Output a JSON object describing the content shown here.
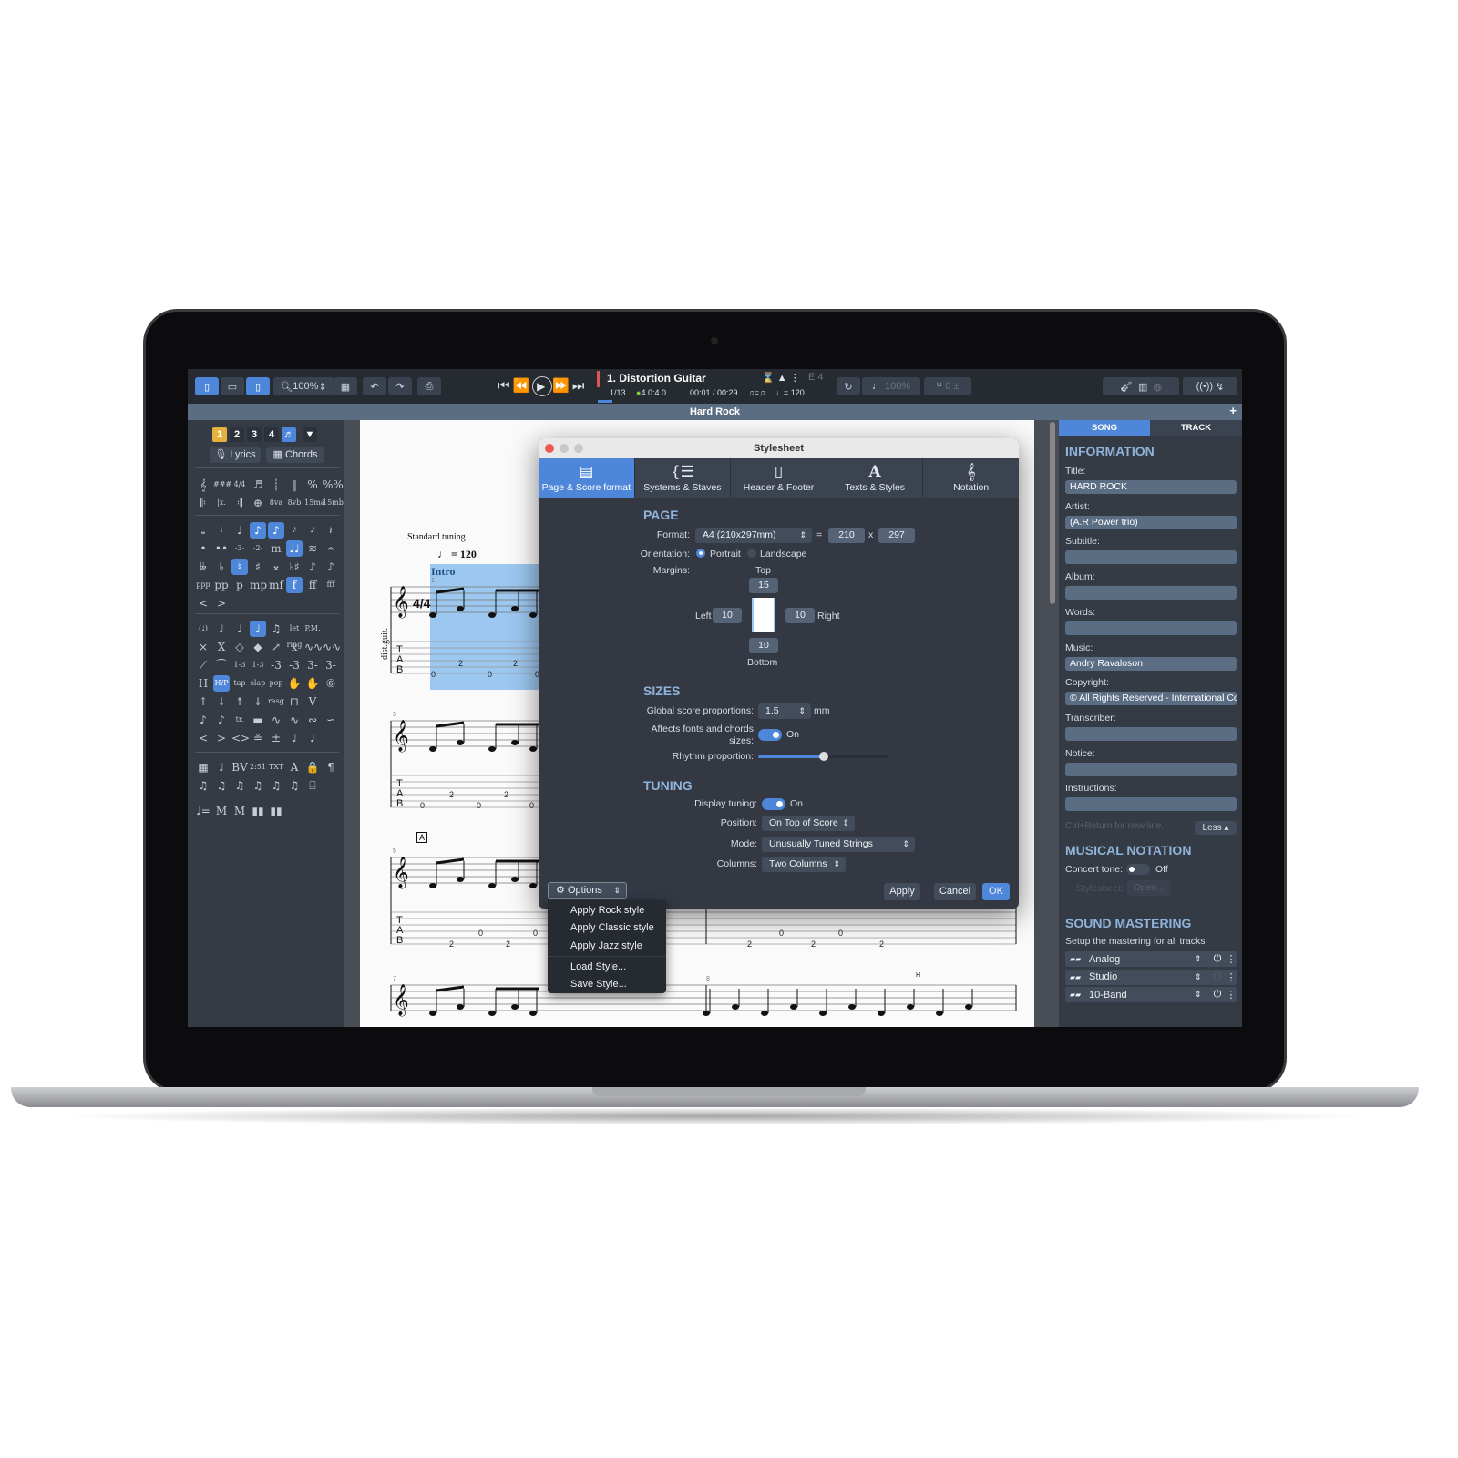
{
  "toolbar": {
    "zoom": "100%",
    "track_name": "1. Distortion Guitar",
    "bar_position": "1/13",
    "time_signature": "4.0:4.0",
    "time": "00:01 / 00:29",
    "tempo_swing": "♫=♫",
    "tempo": "♩= 120",
    "tuning_note": "E 4",
    "speed": "100%",
    "pitch": "0"
  },
  "title_bar": "Hard Rock",
  "left_panel": {
    "voices": [
      "1",
      "2",
      "3",
      "4"
    ],
    "lyrics_label": "Lyrics",
    "chords_label": "Chords",
    "palette_rows": [
      [
        "𝄞",
        "###",
        "4/4",
        "♬",
        "┊",
        "‖",
        "%",
        "%%"
      ],
      [
        "𝄆",
        "|x.",
        "𝄇",
        "⊕",
        "8va",
        "8vb",
        "15ma",
        "15mb"
      ],
      [
        "𝅝",
        "𝅗𝅥",
        "♩",
        "♪",
        "♪",
        "𝅘𝅥𝅯",
        "𝅘𝅥𝅰",
        "𝄽"
      ],
      [
        "•",
        "••",
        "-3-",
        "-2-",
        "m",
        "♩♩",
        "≋",
        "𝄐"
      ],
      [
        "𝄫",
        "♭",
        "♮",
        "♯",
        "𝄪",
        "♭♯",
        "♪",
        "♪"
      ],
      [
        "ppp",
        "pp",
        "p",
        "mp",
        "mf",
        "f",
        "ff",
        "fff"
      ],
      [
        "<",
        ">",
        "",
        "",
        "",
        "",
        "",
        ""
      ],
      [
        "(♩)",
        "♩",
        "♩",
        "♩",
        "♫",
        "let ring",
        "P.M.",
        ""
      ],
      [
        "×",
        "X",
        "◇",
        "◆",
        "↗",
        "x",
        "∿∿",
        "∿∿"
      ],
      [
        "⟋",
        "⁀",
        "1-3",
        "1-3",
        "-3",
        "-3",
        "3-",
        "3-"
      ],
      [
        "H",
        "H/P",
        "tap",
        "slap",
        "pop",
        "✋",
        "✋",
        "⑥"
      ],
      [
        "↑",
        "↓",
        "↟",
        "↡",
        "rasg.",
        "⊓",
        "V",
        ""
      ],
      [
        "♪",
        "♪",
        "tr.",
        "▬",
        "∿",
        "∿",
        "∾",
        "∽"
      ],
      [
        "<",
        ">",
        "<>",
        "≗",
        "±",
        "♩",
        "♩",
        ""
      ],
      [
        "▦",
        "♩",
        "BV",
        "2:51",
        "TXT",
        "A",
        "🔒",
        "¶"
      ],
      [
        "♫",
        "♫",
        "♫",
        "♫",
        "♫",
        "♫",
        "⌸",
        ""
      ],
      [
        "♩=",
        "M",
        "M",
        "▮▮",
        "▮▮",
        "",
        "",
        ""
      ]
    ]
  },
  "score": {
    "tuning_text": "Standard tuning",
    "tempo_text": "♩ = 120",
    "section": "Intro",
    "instrument": "dist.guit.",
    "rehearsal": "A",
    "bar_numbers": [
      "1",
      "3",
      "5",
      "7",
      "8"
    ],
    "tab_letters": [
      "T",
      "A",
      "B"
    ],
    "tab_row1": [
      "0",
      "2",
      "0",
      "2",
      "0"
    ],
    "tab_row2": [
      "0",
      "2",
      "0",
      "2",
      "0"
    ],
    "tab_row3": [
      "2",
      "0",
      "2",
      "0",
      "2",
      "0",
      "2",
      "0",
      "2"
    ],
    "hammer": "H"
  },
  "dialog": {
    "title": "Stylesheet",
    "tabs": [
      {
        "label": "Page & Score format",
        "icon": "page-icon",
        "glyph": "▤"
      },
      {
        "label": "Systems & Staves",
        "icon": "systems-icon",
        "glyph": "{☰"
      },
      {
        "label": "Header & Footer",
        "icon": "header-footer-icon",
        "glyph": "▯"
      },
      {
        "label": "Texts & Styles",
        "icon": "text-icon",
        "glyph": "A"
      },
      {
        "label": "Notation",
        "icon": "treble-clef-icon",
        "glyph": "𝄞"
      }
    ],
    "page": {
      "heading": "PAGE",
      "format_label": "Format:",
      "format_value": "A4 (210x297mm)",
      "equals": "=",
      "width": "210",
      "x": "x",
      "height": "297",
      "orientation_label": "Orientation:",
      "portrait": "Portrait",
      "landscape": "Landscape",
      "margins_label": "Margins:",
      "top_label": "Top",
      "top": "15",
      "left_label": "Left",
      "left": "10",
      "right": "10",
      "right_label": "Right",
      "bottom": "10",
      "bottom_label": "Bottom"
    },
    "sizes": {
      "heading": "SIZES",
      "global_label": "Global score proportions:",
      "global_value": "1.5",
      "unit": "mm",
      "affects_label": "Affects fonts and chords sizes:",
      "affects_state": "On",
      "rhythm_label": "Rhythm proportion:",
      "rhythm_value": 0.5
    },
    "tuning": {
      "heading": "TUNING",
      "display_label": "Display tuning:",
      "display_state": "On",
      "position_label": "Position:",
      "position_value": "On Top of Score",
      "mode_label": "Mode:",
      "mode_value": "Unusually Tuned Strings",
      "columns_label": "Columns:",
      "columns_value": "Two Columns"
    },
    "options_label": "Options",
    "apply": "Apply",
    "cancel": "Cancel",
    "ok": "OK",
    "menu": [
      "Apply Rock style",
      "Apply Classic style",
      "Apply Jazz style",
      "Load Style...",
      "Save Style..."
    ]
  },
  "right_panel": {
    "tabs": [
      "SONG",
      "TRACK"
    ],
    "info_heading": "INFORMATION",
    "fields": [
      {
        "label": "Title:",
        "value": "HARD ROCK"
      },
      {
        "label": "Artist:",
        "value": "(A.R Power trio)"
      },
      {
        "label": "Subtitle:",
        "value": ""
      },
      {
        "label": "Album:",
        "value": ""
      },
      {
        "label": "Words:",
        "value": ""
      },
      {
        "label": "Music:",
        "value": "Andry Ravaloson"
      },
      {
        "label": "Copyright:",
        "value": "© All Rights Reserved - International Copyright"
      },
      {
        "label": "Transcriber:",
        "value": ""
      },
      {
        "label": "Notice:",
        "value": ""
      },
      {
        "label": "Instructions:",
        "value": ""
      }
    ],
    "hint": "Ctrl+Return for new line.",
    "less": "Less ▴",
    "notation_heading": "MUSICAL NOTATION",
    "concert_label": "Concert tone:",
    "concert_state": "Off",
    "stylesheet_label": "Stylesheet:",
    "open_label": "Open...",
    "mastering_heading": "SOUND MASTERING",
    "mastering_sub": "Setup the mastering for all tracks",
    "mastering": [
      {
        "name": "Analog",
        "enabled": true
      },
      {
        "name": "Studio",
        "enabled": false
      },
      {
        "name": "10-Band",
        "enabled": true
      }
    ]
  },
  "colors": {
    "accent": "#4e86d9",
    "heading": "#8fb3da",
    "panel": "#353b45",
    "selection": "#9cc7f0"
  }
}
